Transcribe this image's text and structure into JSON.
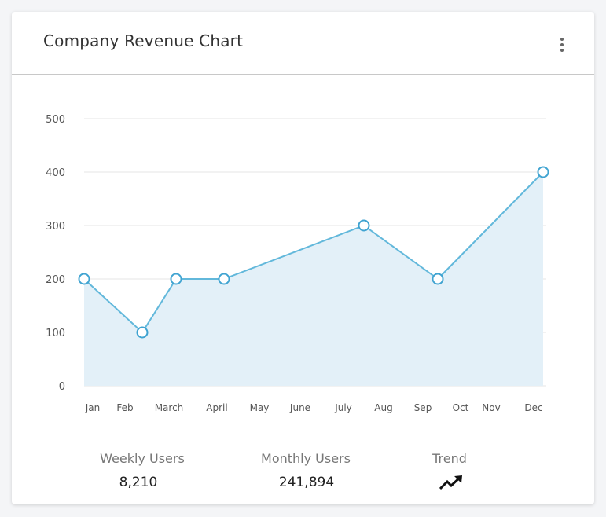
{
  "card": {
    "title": "Company Revenue Chart",
    "menu_icon": "more-vert-icon"
  },
  "chart_data": {
    "type": "area",
    "categories": [
      "Jan",
      "Feb",
      "March",
      "April",
      "May",
      "June",
      "July",
      "Aug",
      "Sep",
      "Oct",
      "Nov",
      "Dec"
    ],
    "points": [
      {
        "month": "Jan",
        "value": 200
      },
      {
        "month": "Feb",
        "value": 100
      },
      {
        "month": "March",
        "value": 200
      },
      {
        "month": "April",
        "value": 200
      },
      {
        "month": "July",
        "value": 300
      },
      {
        "month": "Sep",
        "value": 200
      },
      {
        "month": "Dec",
        "value": 400
      }
    ],
    "yticks": [
      "0",
      "100",
      "200",
      "300",
      "400",
      "500"
    ],
    "ylim": [
      0,
      500
    ],
    "grid": true,
    "line_color": "#62b8db",
    "fill_color": "#e3f0f8"
  },
  "stats": [
    {
      "label": "Weekly Users",
      "value": "8,210"
    },
    {
      "label": "Monthly Users",
      "value": "241,894"
    },
    {
      "label": "Trend",
      "icon": "trending-up-icon"
    }
  ]
}
